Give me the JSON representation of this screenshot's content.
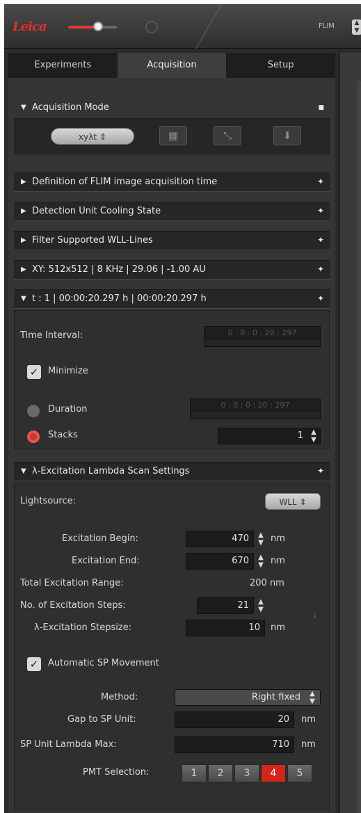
{
  "topbar": {
    "logo": "Leica",
    "mode_label": "FLIM"
  },
  "tabs": [
    {
      "label": "Experiments"
    },
    {
      "label": "Acquisition"
    },
    {
      "label": "Setup"
    }
  ],
  "acquisition_mode": {
    "title": "Acquisition Mode",
    "mode_value": "xyλt",
    "arrow": "▼",
    "pin": "■"
  },
  "sections": {
    "flim_time": "Definition of FLIM image acquisition time",
    "cooling": "Detection Unit Cooling State",
    "wll": "Filter Supported WLL-Lines",
    "xy": "XY: 512x512 | 8 KHz | 29.06 | -1.00 AU",
    "t": "t :    1 |  00:00:20.297 h  |  00:00:20.297 h",
    "lambda": "λ-Excitation Lambda Scan Settings"
  },
  "time_section": {
    "interval_label": "Time Interval:",
    "interval_value": "0 : 0 : 0 : 20 : 297",
    "minimize_label": "Minimize",
    "duration_label": "Duration",
    "duration_value": "0 : 0 : 0 : 20 : 297",
    "stacks_label": "Stacks",
    "stacks_value": "1"
  },
  "lambda_section": {
    "lightsource_label": "Lightsource:",
    "lightsource_value": "WLL",
    "exc_begin_label": "Excitation Begin:",
    "exc_begin_value": "470",
    "exc_end_label": "Excitation End:",
    "exc_end_value": "670",
    "total_range_label": "Total Excitation Range:",
    "total_range_value": "200 nm",
    "steps_label": "No. of Excitation Steps:",
    "steps_value": "21",
    "stepsize_label": "λ-Excitation Stepsize:",
    "stepsize_value": "10",
    "unit_nm": "nm",
    "auto_sp_label": "Automatic SP Movement",
    "method_label": "Method:",
    "method_value": "Right fixed",
    "gap_label": "Gap to SP Unit:",
    "gap_value": "20",
    "sp_max_label": "SP Unit Lambda Max:",
    "sp_max_value": "710",
    "pmt_label": "PMT Selection:",
    "pmt_buttons": [
      "1",
      "2",
      "3",
      "4",
      "5"
    ],
    "pmt_selected": "4"
  },
  "colors": {
    "accent_red": "#d4251c",
    "panel_bg": "#353535",
    "header_bg": "#262626"
  }
}
